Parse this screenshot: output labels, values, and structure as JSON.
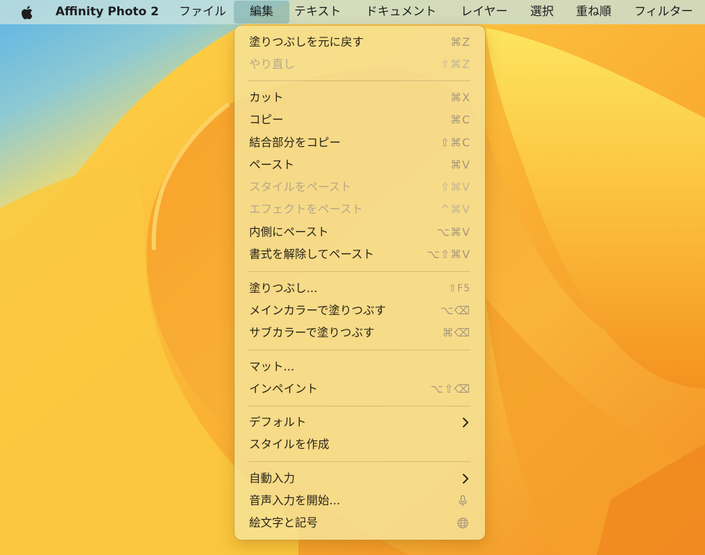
{
  "menubar": {
    "app_name": "Affinity Photo 2",
    "items": [
      "ファイル",
      "編集",
      "テキスト",
      "ドキュメント",
      "レイヤー",
      "選択",
      "重ね順",
      "フィルター"
    ],
    "active_item": "編集"
  },
  "edit_menu": {
    "items": [
      {
        "label": "塗りつぶしを元に戻す",
        "shortcut": "⌘Z",
        "enabled": true
      },
      {
        "label": "やり直し",
        "shortcut": "⇧⌘Z",
        "enabled": false
      },
      {
        "label": "カット",
        "shortcut": "⌘X",
        "enabled": true
      },
      {
        "label": "コピー",
        "shortcut": "⌘C",
        "enabled": true
      },
      {
        "label": "結合部分をコピー",
        "shortcut": "⇧⌘C",
        "enabled": true
      },
      {
        "label": "ペースト",
        "shortcut": "⌘V",
        "enabled": true
      },
      {
        "label": "スタイルをペースト",
        "shortcut": "⇧⌘V",
        "enabled": false
      },
      {
        "label": "エフェクトをペースト",
        "shortcut": "^⌘V",
        "enabled": false
      },
      {
        "label": "内側にペースト",
        "shortcut": "⌥⌘V",
        "enabled": true
      },
      {
        "label": "書式を解除してペースト",
        "shortcut": "⌥⇧⌘V",
        "enabled": true
      },
      {
        "label": "塗りつぶし...",
        "shortcut": "⇧F5",
        "enabled": true
      },
      {
        "label": "メインカラーで塗りつぶす",
        "shortcut": "⌥⌫",
        "enabled": true
      },
      {
        "label": "サブカラーで塗りつぶす",
        "shortcut": "⌘⌫",
        "enabled": true
      },
      {
        "label": "マット...",
        "shortcut": "",
        "enabled": true
      },
      {
        "label": "インペイント",
        "shortcut": "⌥⇧⌫",
        "enabled": true
      },
      {
        "label": "デフォルト",
        "shortcut": "",
        "enabled": true,
        "submenu": true
      },
      {
        "label": "スタイルを作成",
        "shortcut": "",
        "enabled": true
      },
      {
        "label": "自動入力",
        "shortcut": "",
        "enabled": true,
        "submenu": true
      },
      {
        "label": "音声入力を開始...",
        "shortcut": "",
        "enabled": true,
        "icon": "microphone-icon"
      },
      {
        "label": "絵文字と記号",
        "shortcut": "",
        "enabled": true,
        "icon": "globe-icon"
      }
    ]
  },
  "colors": {
    "menubar_bg": "#c8e2de",
    "menu_bg": "#f6e296",
    "wallpaper_orange": "#f7a629",
    "wallpaper_yellow": "#fdd94a",
    "wallpaper_blue": "#5fb6e6"
  }
}
